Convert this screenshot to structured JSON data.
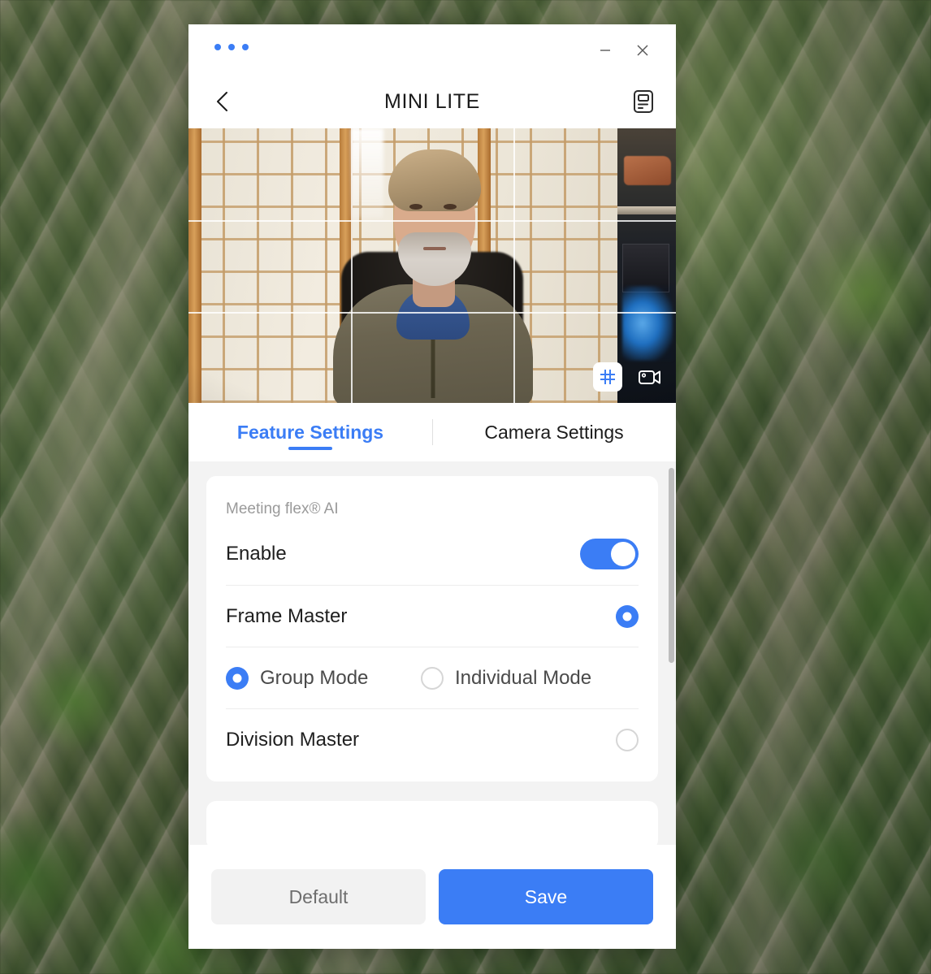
{
  "window": {
    "title": "MINI LITE",
    "menu_icon": "three-dots-icon",
    "minimize_label": "—",
    "close_label": "✕",
    "back_icon": "chevron-left-icon",
    "header_icon": "document-list-icon"
  },
  "video": {
    "grid_tool_icon": "grid-hash-icon",
    "camera_tool_icon": "video-camera-icon",
    "grid_tool_active": true
  },
  "tabs": [
    {
      "label": "Feature Settings",
      "active": true
    },
    {
      "label": "Camera Settings",
      "active": false
    }
  ],
  "settings_card": {
    "title": "Meeting flex® AI",
    "rows": [
      {
        "label": "Enable",
        "control": "toggle",
        "state": "on"
      },
      {
        "label": "Frame Master",
        "control": "radio",
        "state": "checked"
      },
      {
        "label": "Division Master",
        "control": "radio",
        "state": "unchecked"
      }
    ],
    "modes": [
      {
        "label": "Group Mode",
        "state": "checked"
      },
      {
        "label": "Individual Mode",
        "state": "unchecked"
      }
    ]
  },
  "footer": {
    "default_label": "Default",
    "save_label": "Save"
  },
  "colors": {
    "accent": "#3B7DF5",
    "content_bg": "#F3F3F3",
    "muted_text": "#9a9a9a",
    "default_btn_bg": "#F2F2F2"
  }
}
